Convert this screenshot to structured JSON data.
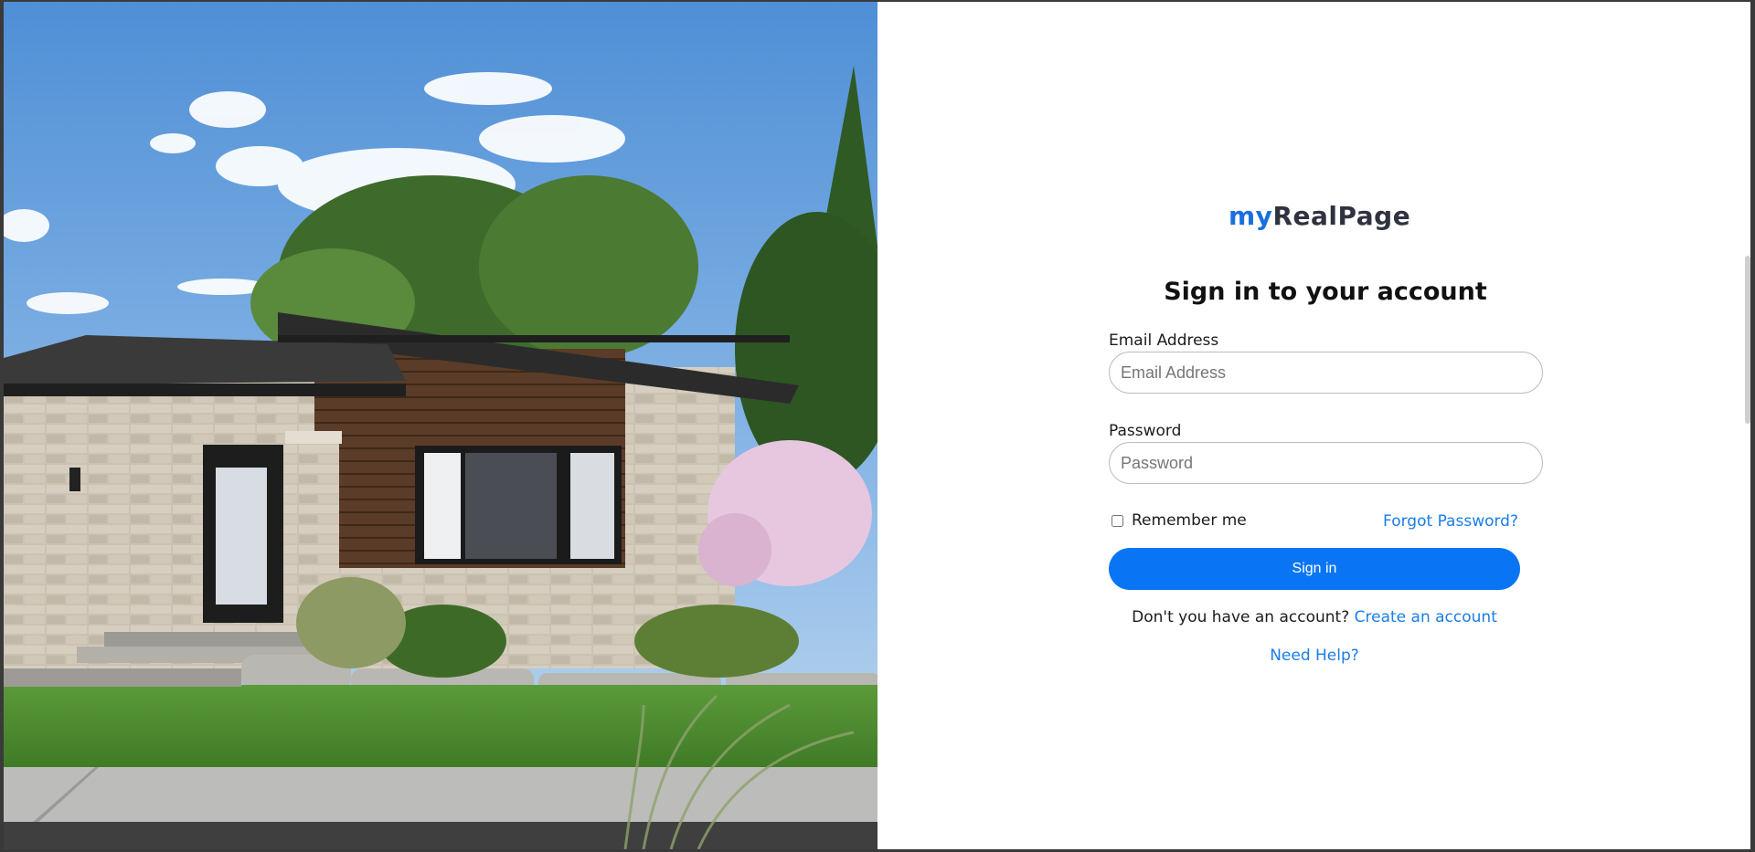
{
  "brand": {
    "logo_prefix": "my",
    "logo_suffix": "RealPage",
    "accent": "#0a75f4",
    "link_color": "#1a7ee6"
  },
  "hero": {
    "image": "modern-house-exterior"
  },
  "form": {
    "title": "Sign in to your account",
    "email_label": "Email Address",
    "email_placeholder": "Email Address",
    "email_value": "",
    "password_label": "Password",
    "password_placeholder": "Password",
    "password_value": "",
    "remember_label": "Remember me",
    "remember_checked": false,
    "forgot_label": "Forgot Password?",
    "signin_label": "Sign in",
    "no_account_text": "Don't you have an account?",
    "create_account_label": "Create an account",
    "help_label": "Need Help?"
  }
}
